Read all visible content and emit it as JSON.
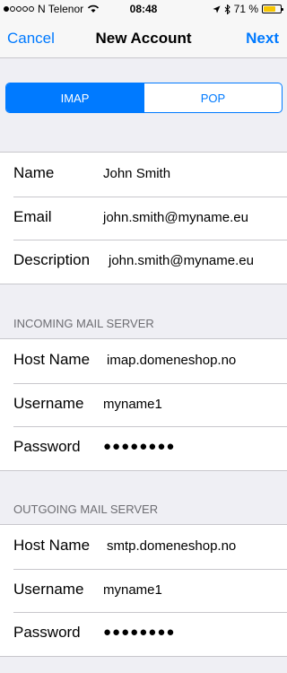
{
  "status_bar": {
    "carrier": "N Telenor",
    "time": "08:48",
    "battery_percent": "71 %",
    "battery_level": 0.71
  },
  "nav": {
    "cancel": "Cancel",
    "title": "New Account",
    "next": "Next"
  },
  "segments": {
    "imap": "IMAP",
    "pop": "POP",
    "selected": "IMAP"
  },
  "account": {
    "name_label": "Name",
    "name_value": "John Smith",
    "email_label": "Email",
    "email_value": "john.smith@myname.eu",
    "description_label": "Description",
    "description_value": "john.smith@myname.eu"
  },
  "incoming": {
    "header": "INCOMING MAIL SERVER",
    "host_label": "Host Name",
    "host_value": "imap.domeneshop.no",
    "username_label": "Username",
    "username_value": "myname1",
    "password_label": "Password",
    "password_value": "●●●●●●●●"
  },
  "outgoing": {
    "header": "OUTGOING MAIL SERVER",
    "host_label": "Host Name",
    "host_value": "smtp.domeneshop.no",
    "username_label": "Username",
    "username_value": "myname1",
    "password_label": "Password",
    "password_value": "●●●●●●●●"
  },
  "colors": {
    "accent": "#007aff",
    "background": "#efeff4",
    "battery_fill": "#f7c600"
  }
}
